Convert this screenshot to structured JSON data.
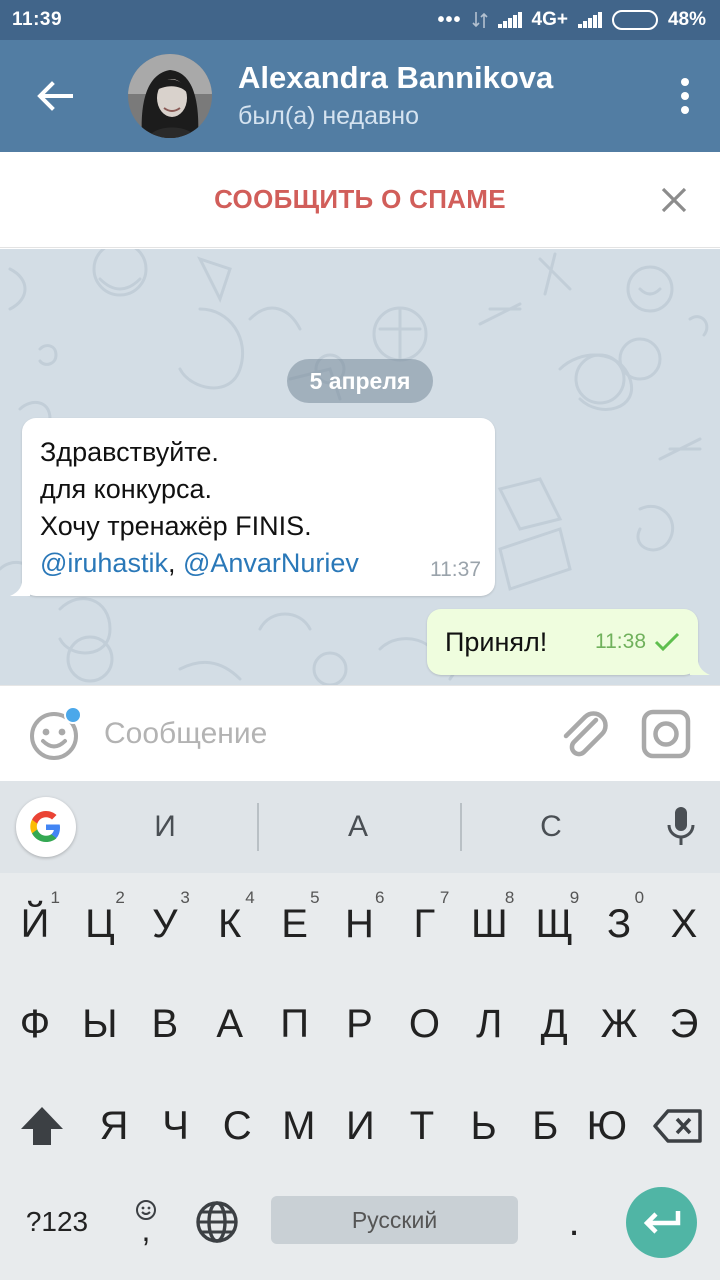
{
  "status_bar": {
    "time": "11:39",
    "network": "4G+",
    "battery": "48%",
    "battery_level": 0.48
  },
  "header": {
    "back_icon": "arrow-left-icon",
    "title": "Alexandra Bannikova",
    "subtitle": "был(а) недавно",
    "menu_icon": "more-vertical-icon"
  },
  "spam_bar": {
    "label": "СООБЩИТЬ О СПАМЕ",
    "close_icon": "close-icon"
  },
  "chat": {
    "date_label": "5 апреля",
    "messages": [
      {
        "direction": "incoming",
        "lines": [
          "Здравствуйте.",
          "для конкурса.",
          "Хочу тренажёр FINIS."
        ],
        "mention_1": "@iruhastik",
        "separator": ", ",
        "mention_2": "@AnvarNuriev",
        "time": "11:37"
      },
      {
        "direction": "outgoing",
        "text": "Принял!",
        "time": "11:38",
        "status_icon": "check-icon"
      }
    ]
  },
  "composer": {
    "placeholder": "Сообщение",
    "emoji_icon": "emoji-icon",
    "attach_icon": "paperclip-icon",
    "camera_icon": "camera-icon"
  },
  "keyboard": {
    "suggestions": [
      "И",
      "А",
      "С"
    ],
    "row1": [
      {
        "label": "Й",
        "hint": "1"
      },
      {
        "label": "Ц",
        "hint": "2"
      },
      {
        "label": "У",
        "hint": "3"
      },
      {
        "label": "К",
        "hint": "4"
      },
      {
        "label": "Е",
        "hint": "5"
      },
      {
        "label": "Н",
        "hint": "6"
      },
      {
        "label": "Г",
        "hint": "7"
      },
      {
        "label": "Ш",
        "hint": "8"
      },
      {
        "label": "Щ",
        "hint": "9"
      },
      {
        "label": "З",
        "hint": "0"
      },
      {
        "label": "Х",
        "hint": ""
      }
    ],
    "row2": [
      "Ф",
      "Ы",
      "В",
      "А",
      "П",
      "Р",
      "О",
      "Л",
      "Д",
      "Ж",
      "Э"
    ],
    "row3": [
      "Я",
      "Ч",
      "С",
      "М",
      "И",
      "Т",
      "Ь",
      "Б",
      "Ю"
    ],
    "symbols_label": "?123",
    "comma_label": ",",
    "space_label": "Русский",
    "period_label": ".",
    "colors": {
      "enter": "#50b5a5",
      "header": "#527da3",
      "spam": "#d15e5a",
      "link": "#2a78b8"
    }
  }
}
